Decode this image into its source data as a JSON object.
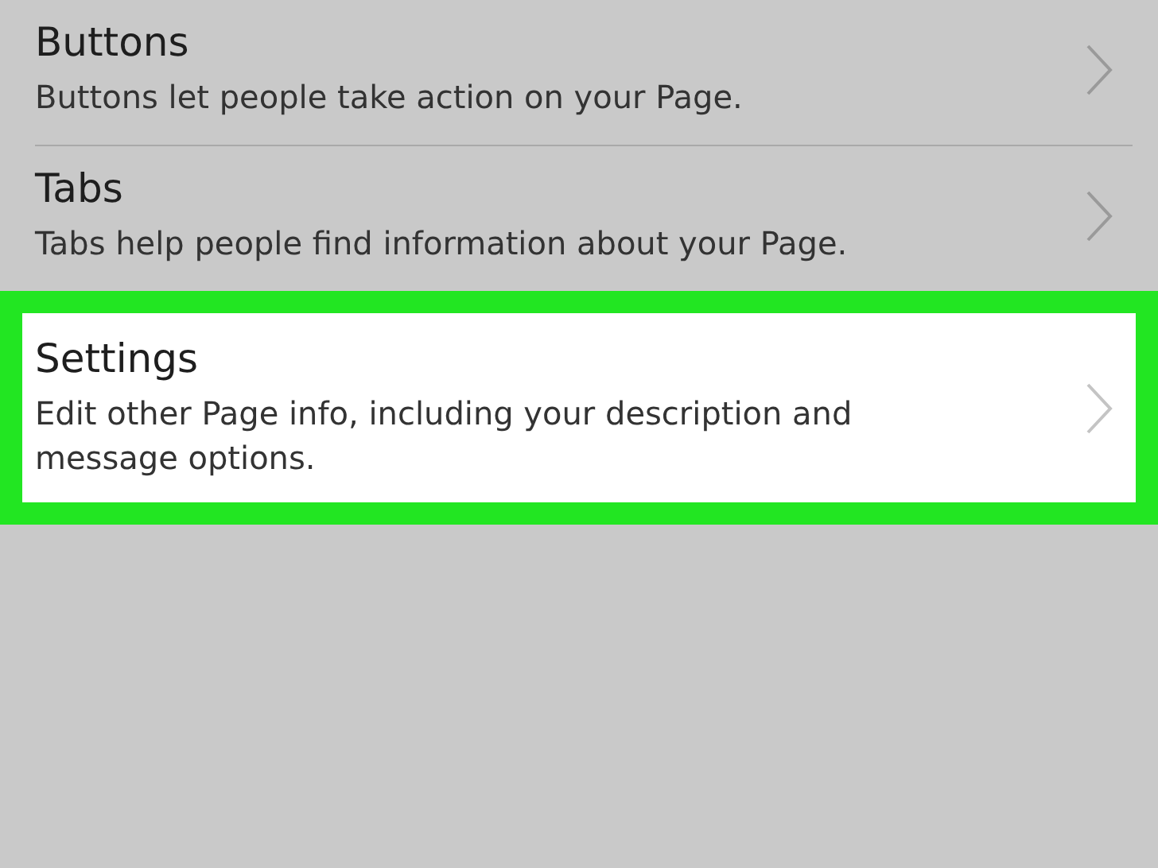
{
  "items": [
    {
      "title": "Buttons",
      "description": "Buttons let people take action on your Page.",
      "highlighted": false
    },
    {
      "title": "Tabs",
      "description": "Tabs help people find information about your Page.",
      "highlighted": false
    },
    {
      "title": "Settings",
      "description": "Edit other Page info, including your description and message options.",
      "highlighted": true
    }
  ]
}
